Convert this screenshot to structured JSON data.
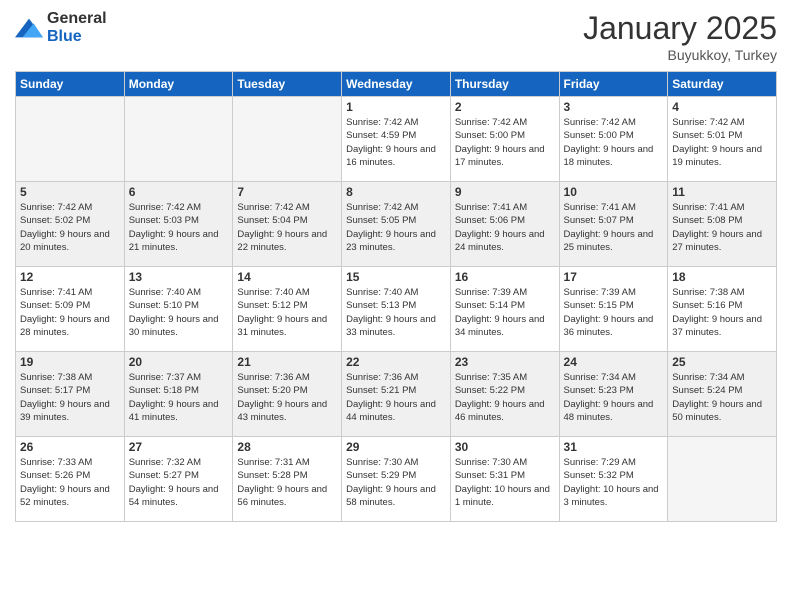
{
  "logo": {
    "general": "General",
    "blue": "Blue"
  },
  "header": {
    "month": "January 2025",
    "location": "Buyukkoy, Turkey"
  },
  "weekdays": [
    "Sunday",
    "Monday",
    "Tuesday",
    "Wednesday",
    "Thursday",
    "Friday",
    "Saturday"
  ],
  "weeks": [
    {
      "shaded": false,
      "days": [
        {
          "num": "",
          "empty": true
        },
        {
          "num": "",
          "empty": true
        },
        {
          "num": "",
          "empty": true
        },
        {
          "num": "1",
          "sunrise": "7:42 AM",
          "sunset": "4:59 PM",
          "daylight": "9 hours and 16 minutes."
        },
        {
          "num": "2",
          "sunrise": "7:42 AM",
          "sunset": "5:00 PM",
          "daylight": "9 hours and 17 minutes."
        },
        {
          "num": "3",
          "sunrise": "7:42 AM",
          "sunset": "5:00 PM",
          "daylight": "9 hours and 18 minutes."
        },
        {
          "num": "4",
          "sunrise": "7:42 AM",
          "sunset": "5:01 PM",
          "daylight": "9 hours and 19 minutes."
        }
      ]
    },
    {
      "shaded": true,
      "days": [
        {
          "num": "5",
          "sunrise": "7:42 AM",
          "sunset": "5:02 PM",
          "daylight": "9 hours and 20 minutes."
        },
        {
          "num": "6",
          "sunrise": "7:42 AM",
          "sunset": "5:03 PM",
          "daylight": "9 hours and 21 minutes."
        },
        {
          "num": "7",
          "sunrise": "7:42 AM",
          "sunset": "5:04 PM",
          "daylight": "9 hours and 22 minutes."
        },
        {
          "num": "8",
          "sunrise": "7:42 AM",
          "sunset": "5:05 PM",
          "daylight": "9 hours and 23 minutes."
        },
        {
          "num": "9",
          "sunrise": "7:41 AM",
          "sunset": "5:06 PM",
          "daylight": "9 hours and 24 minutes."
        },
        {
          "num": "10",
          "sunrise": "7:41 AM",
          "sunset": "5:07 PM",
          "daylight": "9 hours and 25 minutes."
        },
        {
          "num": "11",
          "sunrise": "7:41 AM",
          "sunset": "5:08 PM",
          "daylight": "9 hours and 27 minutes."
        }
      ]
    },
    {
      "shaded": false,
      "days": [
        {
          "num": "12",
          "sunrise": "7:41 AM",
          "sunset": "5:09 PM",
          "daylight": "9 hours and 28 minutes."
        },
        {
          "num": "13",
          "sunrise": "7:40 AM",
          "sunset": "5:10 PM",
          "daylight": "9 hours and 30 minutes."
        },
        {
          "num": "14",
          "sunrise": "7:40 AM",
          "sunset": "5:12 PM",
          "daylight": "9 hours and 31 minutes."
        },
        {
          "num": "15",
          "sunrise": "7:40 AM",
          "sunset": "5:13 PM",
          "daylight": "9 hours and 33 minutes."
        },
        {
          "num": "16",
          "sunrise": "7:39 AM",
          "sunset": "5:14 PM",
          "daylight": "9 hours and 34 minutes."
        },
        {
          "num": "17",
          "sunrise": "7:39 AM",
          "sunset": "5:15 PM",
          "daylight": "9 hours and 36 minutes."
        },
        {
          "num": "18",
          "sunrise": "7:38 AM",
          "sunset": "5:16 PM",
          "daylight": "9 hours and 37 minutes."
        }
      ]
    },
    {
      "shaded": true,
      "days": [
        {
          "num": "19",
          "sunrise": "7:38 AM",
          "sunset": "5:17 PM",
          "daylight": "9 hours and 39 minutes."
        },
        {
          "num": "20",
          "sunrise": "7:37 AM",
          "sunset": "5:18 PM",
          "daylight": "9 hours and 41 minutes."
        },
        {
          "num": "21",
          "sunrise": "7:36 AM",
          "sunset": "5:20 PM",
          "daylight": "9 hours and 43 minutes."
        },
        {
          "num": "22",
          "sunrise": "7:36 AM",
          "sunset": "5:21 PM",
          "daylight": "9 hours and 44 minutes."
        },
        {
          "num": "23",
          "sunrise": "7:35 AM",
          "sunset": "5:22 PM",
          "daylight": "9 hours and 46 minutes."
        },
        {
          "num": "24",
          "sunrise": "7:34 AM",
          "sunset": "5:23 PM",
          "daylight": "9 hours and 48 minutes."
        },
        {
          "num": "25",
          "sunrise": "7:34 AM",
          "sunset": "5:24 PM",
          "daylight": "9 hours and 50 minutes."
        }
      ]
    },
    {
      "shaded": false,
      "days": [
        {
          "num": "26",
          "sunrise": "7:33 AM",
          "sunset": "5:26 PM",
          "daylight": "9 hours and 52 minutes."
        },
        {
          "num": "27",
          "sunrise": "7:32 AM",
          "sunset": "5:27 PM",
          "daylight": "9 hours and 54 minutes."
        },
        {
          "num": "28",
          "sunrise": "7:31 AM",
          "sunset": "5:28 PM",
          "daylight": "9 hours and 56 minutes."
        },
        {
          "num": "29",
          "sunrise": "7:30 AM",
          "sunset": "5:29 PM",
          "daylight": "9 hours and 58 minutes."
        },
        {
          "num": "30",
          "sunrise": "7:30 AM",
          "sunset": "5:31 PM",
          "daylight": "10 hours and 1 minute."
        },
        {
          "num": "31",
          "sunrise": "7:29 AM",
          "sunset": "5:32 PM",
          "daylight": "10 hours and 3 minutes."
        },
        {
          "num": "",
          "empty": true
        }
      ]
    }
  ]
}
